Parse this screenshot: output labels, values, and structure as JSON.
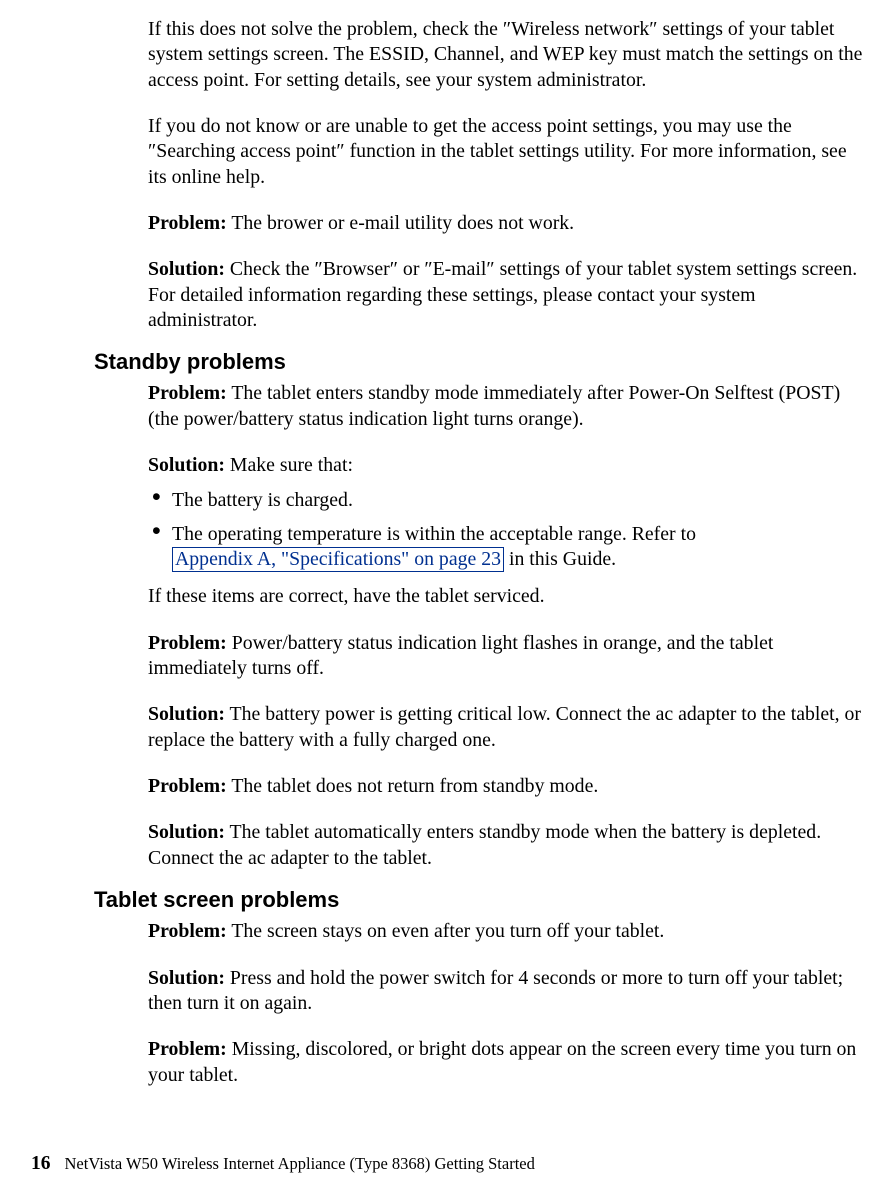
{
  "intro": {
    "para1": "If this does not solve the problem, check the ″Wireless network″ settings of your tablet system settings screen. The ESSID, Channel, and WEP key must match the settings on the access point. For setting details, see your system administrator.",
    "para2": "If you do not know or are unable to get the access point settings, you may use the ″Searching access point″ function in the tablet settings utility. For more information, see its online help."
  },
  "labels": {
    "problem": "Problem:",
    "solution": "Solution:"
  },
  "item1": {
    "problem_text": " The brower or e-mail utility does not work.",
    "solution_text": " Check the ″Browser″ or ″E-mail″ settings of your tablet system settings screen. For detailed information regarding these settings, please contact your system administrator."
  },
  "heading_standby": "Standby problems",
  "standby1": {
    "problem_text": " The tablet enters standby mode immediately after Power-On Selftest (POST) (the power/battery status indication light turns orange).",
    "solution_text": " Make sure that:",
    "bullets": {
      "b1": "The battery is charged.",
      "b2_pre": "The operating temperature is within the acceptable range. Refer to ",
      "b2_link": "Appendix A, \"Specifications\" on page 23",
      "b2_post": " in this Guide."
    },
    "after": "If these items are correct, have the tablet serviced."
  },
  "standby2": {
    "problem_text": " Power/battery status indication light flashes in orange, and the tablet immediately turns off.",
    "solution_text": " The battery power is getting critical low. Connect the ac adapter to the tablet, or replace the battery with a fully charged one."
  },
  "standby3": {
    "problem_text": " The tablet does not return from standby mode.",
    "solution_text": " The tablet automatically enters standby mode when the battery is depleted. Connect the ac adapter to the tablet."
  },
  "heading_screen": "Tablet screen problems",
  "screen1": {
    "problem_text": " The screen stays on even after you turn off your tablet.",
    "solution_text": " Press and hold the power switch for 4 seconds or more to turn off your tablet; then turn it on again."
  },
  "screen2": {
    "problem_text": " Missing, discolored, or bright dots appear on the screen every time you turn on your tablet."
  },
  "footer": {
    "pagenum": "16",
    "title": "NetVista W50 Wireless Internet Appliance (Type 8368) Getting Started"
  }
}
